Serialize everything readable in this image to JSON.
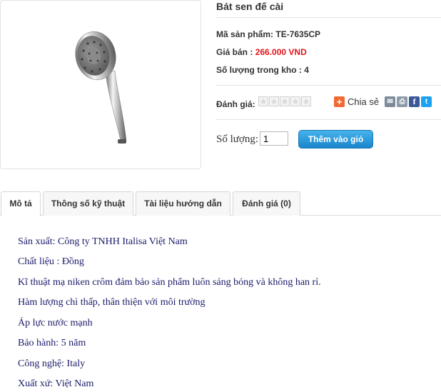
{
  "product": {
    "title": "Bát sen đế cài",
    "code_label": "Mã sản phẩm:",
    "code_value": "TE-7635CP",
    "price_label": "Giá bán :",
    "price_value": "266.000 VND",
    "stock_label": "Số lượng trong kho",
    "stock_value": ": 4",
    "rating_label": "Đánh giá:",
    "rating_value": 0,
    "rating_max": 5
  },
  "share": {
    "label": "Chia sẻ",
    "icons": [
      "plus-icon",
      "email-icon",
      "print-icon",
      "facebook-icon",
      "twitter-icon"
    ],
    "colors": {
      "plus": "#f06a35",
      "email": "#7d8a99",
      "print": "#8c9aa8",
      "facebook": "#3b5998",
      "twitter": "#1da1f2"
    }
  },
  "cart": {
    "qty_label": "Số lượng:",
    "qty_value": "1",
    "add_button": "Thêm vào giỏ"
  },
  "tabs": [
    {
      "label": "Mô tả",
      "active": true
    },
    {
      "label": "Thông số kỹ thuật",
      "active": false
    },
    {
      "label": "Tài liệu hướng dẫn",
      "active": false
    },
    {
      "label": "Đánh giá (0)",
      "active": false
    }
  ],
  "description": [
    "Sản xuất: Công ty TNHH Italisa Việt Nam",
    "Chất liệu : Đồng",
    "Kĩ thuật mạ niken crôm đảm bảo sản phẩm luôn sáng bóng và không han rỉ.",
    "Hàm lượng chì thấp, thân thiện với môi trường",
    "Áp lực nước mạnh",
    "Bảo hành: 5 năm",
    "Công nghệ: Italy",
    "Xuất xứ: Việt Nam"
  ],
  "colors": {
    "price": "#e0161b",
    "button": "#1a86cc",
    "description_text": "#1a1a6b"
  }
}
